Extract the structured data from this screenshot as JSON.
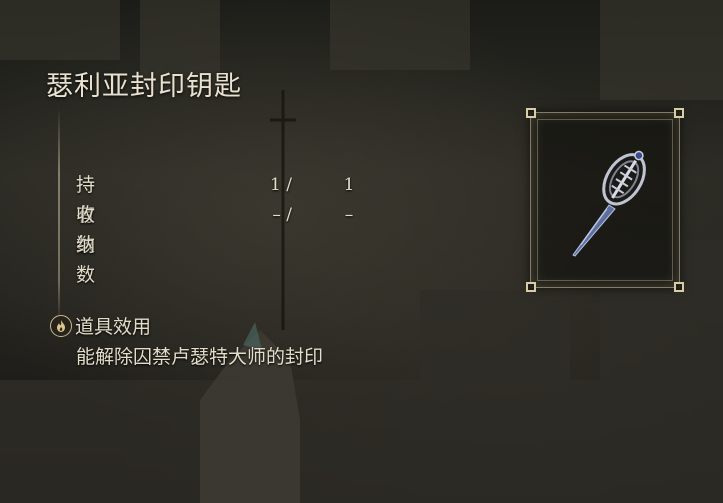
{
  "item": {
    "name": "瑟利亚封印钥匙",
    "icon": "seal-key-icon"
  },
  "stats": [
    {
      "label": "持有数",
      "held": "1 /",
      "max": "1"
    },
    {
      "label": "收纳数",
      "held": "– /",
      "max": "–"
    }
  ],
  "effect": {
    "icon": "flame-circle-icon",
    "title": "道具效用",
    "text": "能解除囚禁卢瑟特大师的封印"
  },
  "colors": {
    "text": "#e3dcc9",
    "frame": "#d8cca4",
    "background": "#25241f"
  }
}
